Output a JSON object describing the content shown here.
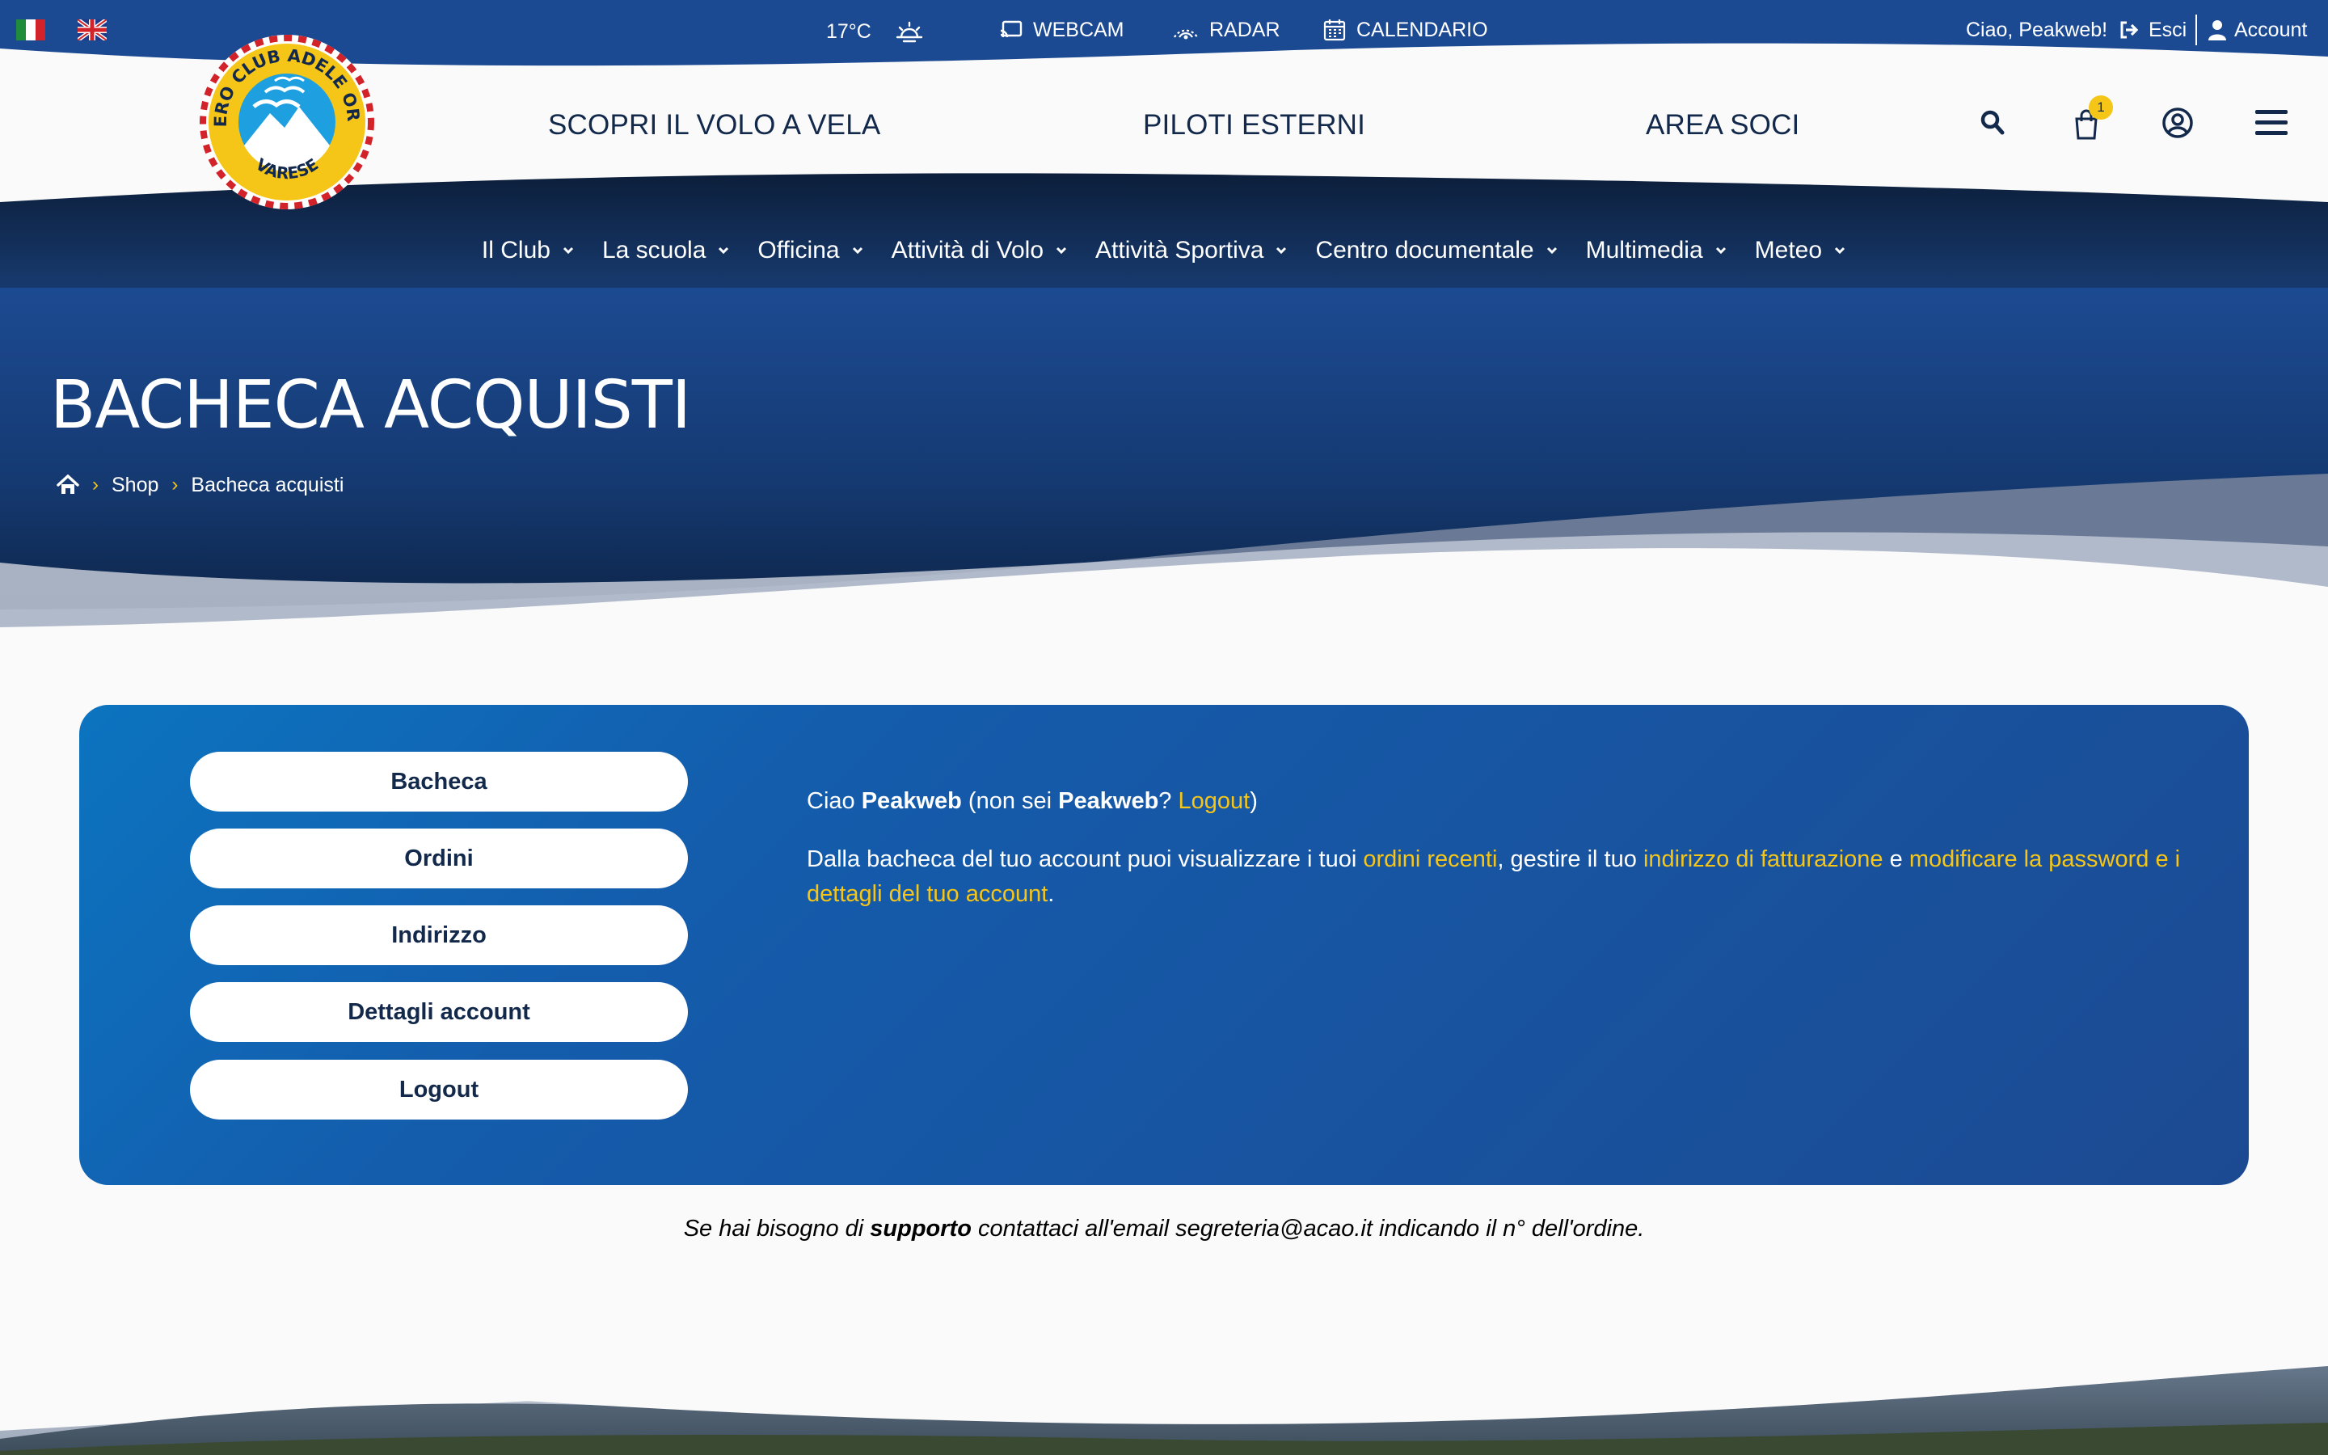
{
  "topbar": {
    "temperature": "17°C",
    "links": [
      {
        "label": "WEBCAM",
        "icon": "cast-icon"
      },
      {
        "label": "RADAR",
        "icon": "radar-icon"
      },
      {
        "label": "CALENDARIO",
        "icon": "calendar-icon"
      }
    ],
    "greeting": "Ciao, Peakweb!",
    "logout_label": "Esci",
    "account_label": "Account"
  },
  "logo": {
    "ring_text_top": "AERO CLUB ADELE ORSI",
    "ring_text_bottom": "VARESE"
  },
  "header": {
    "nav": [
      "SCOPRI IL VOLO A VELA",
      "PILOTI ESTERNI",
      "AREA SOCI"
    ],
    "cart_count": "1"
  },
  "subnav": [
    "Il Club",
    "La scuola",
    "Officina",
    "Attività di Volo",
    "Attività Sportiva",
    "Centro documentale",
    "Multimedia",
    "Meteo"
  ],
  "hero": {
    "title": "BACHECA ACQUISTI",
    "breadcrumb": [
      "Shop",
      "Bacheca acquisti"
    ]
  },
  "account_menu": [
    "Bacheca",
    "Ordini",
    "Indirizzo",
    "Dettagli account",
    "Logout"
  ],
  "dashboard": {
    "hello": "Ciao",
    "user": "Peakweb",
    "not_you_open": "(non sei",
    "not_you_q": "?",
    "logout_link": "Logout",
    "close_paren": ")",
    "desc_1": "Dalla bacheca del tuo account puoi visualizzare i tuoi",
    "link_orders": "ordini recenti",
    "desc_2": ", gestire il tuo",
    "link_billing": "indirizzo di fatturazione",
    "desc_3": "e",
    "link_password": "modificare la password e i dettagli del tuo account",
    "desc_4": "."
  },
  "support": {
    "prefix": "Se hai bisogno di",
    "bold": "supporto",
    "suffix": "contattaci all'email segreteria@acao.it indicando il n° dell'ordine."
  },
  "colors": {
    "navy": "#1c4a92",
    "dark_navy": "#0f2748",
    "accent_yellow": "#f5c518",
    "white": "#ffffff"
  }
}
